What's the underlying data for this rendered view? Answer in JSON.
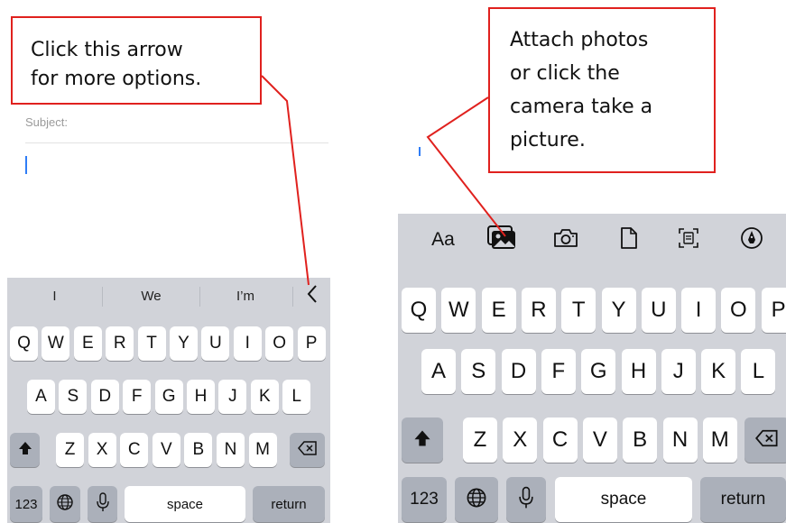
{
  "left": {
    "callout": {
      "line1": "Click this arrow",
      "line2": "for more options."
    },
    "subject_label": "Subject:",
    "suggestions": [
      "I",
      "We",
      "I’m"
    ],
    "keyboard": {
      "row1": [
        "Q",
        "W",
        "E",
        "R",
        "T",
        "Y",
        "U",
        "I",
        "O",
        "P"
      ],
      "row2": [
        "A",
        "S",
        "D",
        "F",
        "G",
        "H",
        "J",
        "K",
        "L"
      ],
      "row3": [
        "Z",
        "X",
        "C",
        "V",
        "B",
        "N",
        "M"
      ],
      "numbers_label": "123",
      "space_label": "space",
      "return_label": "return"
    }
  },
  "right": {
    "callout": {
      "line1": "Attach photos",
      "line2": "or click the",
      "line3": "camera take a",
      "line4": "picture."
    },
    "format_label": "Aa",
    "keyboard": {
      "row1": [
        "Q",
        "W",
        "E",
        "R",
        "T",
        "Y",
        "U",
        "I",
        "O",
        "P"
      ],
      "row2": [
        "A",
        "S",
        "D",
        "F",
        "G",
        "H",
        "J",
        "K",
        "L"
      ],
      "row3": [
        "Z",
        "X",
        "C",
        "V",
        "B",
        "N",
        "M"
      ],
      "numbers_label": "123",
      "space_label": "space",
      "return_label": "return"
    }
  },
  "colors": {
    "callout_border": "#e0211e",
    "keyboard_bg": "#d1d3d9",
    "cursor": "#2f7df6"
  },
  "icons": [
    "chevron-left-icon",
    "globe-icon",
    "microphone-icon",
    "shift-icon",
    "delete-icon",
    "photo-library-icon",
    "camera-icon",
    "document-icon",
    "scan-document-icon",
    "markup-icon"
  ]
}
